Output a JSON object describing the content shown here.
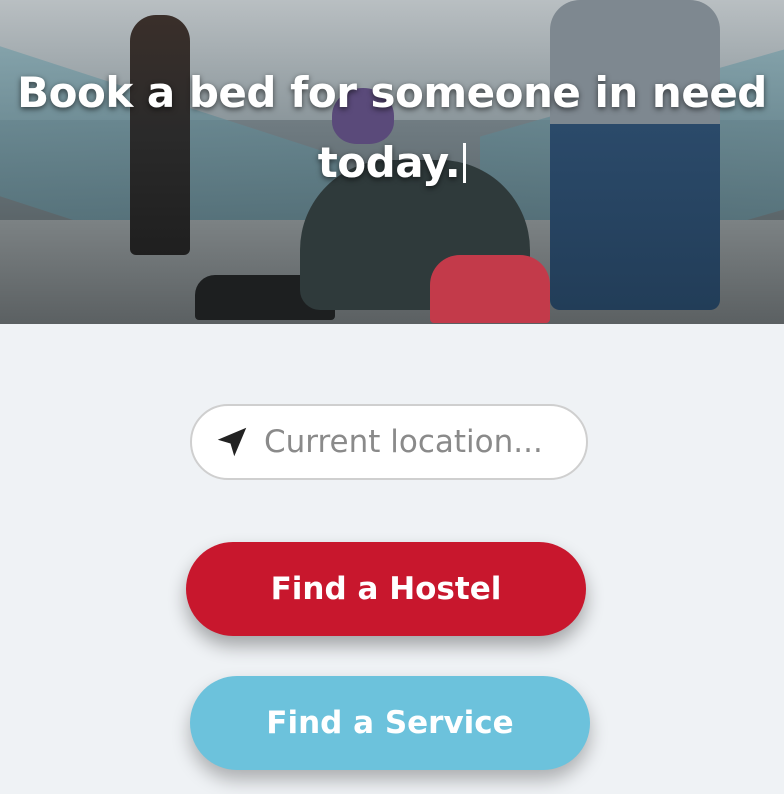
{
  "hero": {
    "title_line1": "Book a bed for someone in need",
    "title_line2": "today."
  },
  "location": {
    "placeholder": "Current location...",
    "icon": "navigation-arrow-icon"
  },
  "buttons": {
    "hostel_label": "Find a Hostel",
    "service_label": "Find a Service"
  },
  "colors": {
    "hostel_button": "#c8172d",
    "service_button": "#6cc2dc",
    "background": "#eff2f5"
  }
}
